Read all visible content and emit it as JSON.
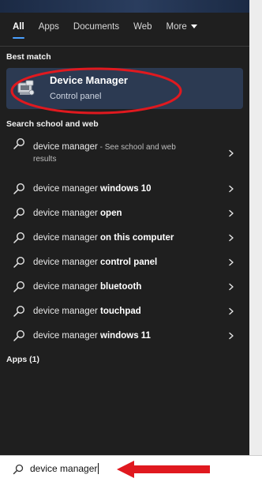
{
  "tabs": [
    {
      "label": "All"
    },
    {
      "label": "Apps"
    },
    {
      "label": "Documents"
    },
    {
      "label": "Web"
    },
    {
      "label": "More"
    }
  ],
  "best_match": {
    "section_label": "Best match",
    "title": "Device Manager",
    "subtitle": "Control panel",
    "icon": "device-manager-icon"
  },
  "web": {
    "section_label": "Search school and web",
    "results": [
      {
        "prefix": "device manager",
        "bold": "",
        "note": " - See school and web",
        "note2": "results"
      },
      {
        "prefix": "device manager ",
        "bold": "windows 10",
        "note": "",
        "note2": ""
      },
      {
        "prefix": "device manager ",
        "bold": "open",
        "note": "",
        "note2": ""
      },
      {
        "prefix": "device manager ",
        "bold": "on this computer",
        "note": "",
        "note2": ""
      },
      {
        "prefix": "device manager ",
        "bold": "control panel",
        "note": "",
        "note2": ""
      },
      {
        "prefix": "device manager ",
        "bold": "bluetooth",
        "note": "",
        "note2": ""
      },
      {
        "prefix": "device manager ",
        "bold": "touchpad",
        "note": "",
        "note2": ""
      },
      {
        "prefix": "device manager ",
        "bold": "windows 11",
        "note": "",
        "note2": ""
      }
    ]
  },
  "apps": {
    "section_label": "Apps (1)"
  },
  "search": {
    "value": "device manager"
  },
  "colors": {
    "panel": "#1f1f1f",
    "highlight": "#2c3a52",
    "annotation": "#e0191f",
    "accent": "#4aa0ff"
  }
}
